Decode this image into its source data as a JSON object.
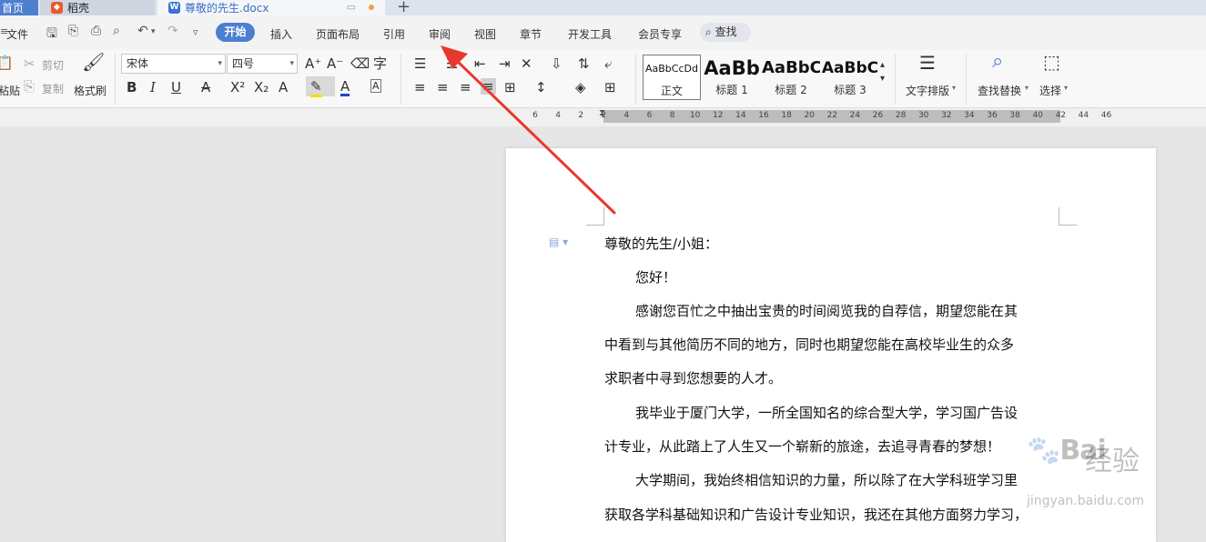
{
  "tabs": {
    "home": "首页",
    "daoke": "稻壳",
    "doc": "尊敬的先生.docx",
    "new_tab": "+"
  },
  "menu": {
    "file": "文件",
    "start": "开始",
    "insert": "插入",
    "layout": "页面布局",
    "reference": "引用",
    "review": "审阅",
    "view": "视图",
    "chapter": "章节",
    "devtools": "开发工具",
    "member": "会员专享",
    "search": "查找"
  },
  "ribbon": {
    "paste": "粘贴",
    "cut": "剪切",
    "copy": "复制",
    "format_painter": "格式刷",
    "font_name": "宋体",
    "font_size": "四号",
    "styles": [
      {
        "preview": "AaBbCcDd",
        "name": "正文"
      },
      {
        "preview": "AaBb",
        "name": "标题 1"
      },
      {
        "preview": "AaBbC",
        "name": "标题 2"
      },
      {
        "preview": "AaBbC",
        "name": "标题 3"
      }
    ],
    "text_layout": "文字排版",
    "find_replace": "查找替换",
    "select": "选择"
  },
  "ruler": {
    "ticks": [
      "6",
      "4",
      "2",
      "2",
      "4",
      "6",
      "8",
      "10",
      "12",
      "14",
      "16",
      "18",
      "20",
      "22",
      "24",
      "26",
      "28",
      "30",
      "32",
      "34",
      "36",
      "38",
      "40",
      "42",
      "44",
      "46"
    ]
  },
  "document": {
    "lines": [
      "尊敬的先生/小姐：",
      "您好！",
      "感谢您百忙之中抽出宝贵的时间阅览我的自荐信，期望您能在其",
      "中看到与其他简历不同的地方，同时也期望您能在高校毕业生的众多",
      "求职者中寻到您想要的人才。",
      "我毕业于厦门大学，一所全国知名的综合型大学，学习国广告设",
      "计专业，从此踏上了人生又一个崭新的旅途，去追寻青春的梦想！",
      "大学期间，我始终相信知识的力量，所以除了在大学科班学习里",
      "获取各学科基础知识和广告设计专业知识，我还在其他方面努力学习，"
    ]
  },
  "watermark": {
    "brand": "Bai",
    "title": "经验",
    "url": "jingyan.baidu.com"
  },
  "colors": {
    "accent": "#4d7fd0",
    "arrow": "#e8382e"
  }
}
